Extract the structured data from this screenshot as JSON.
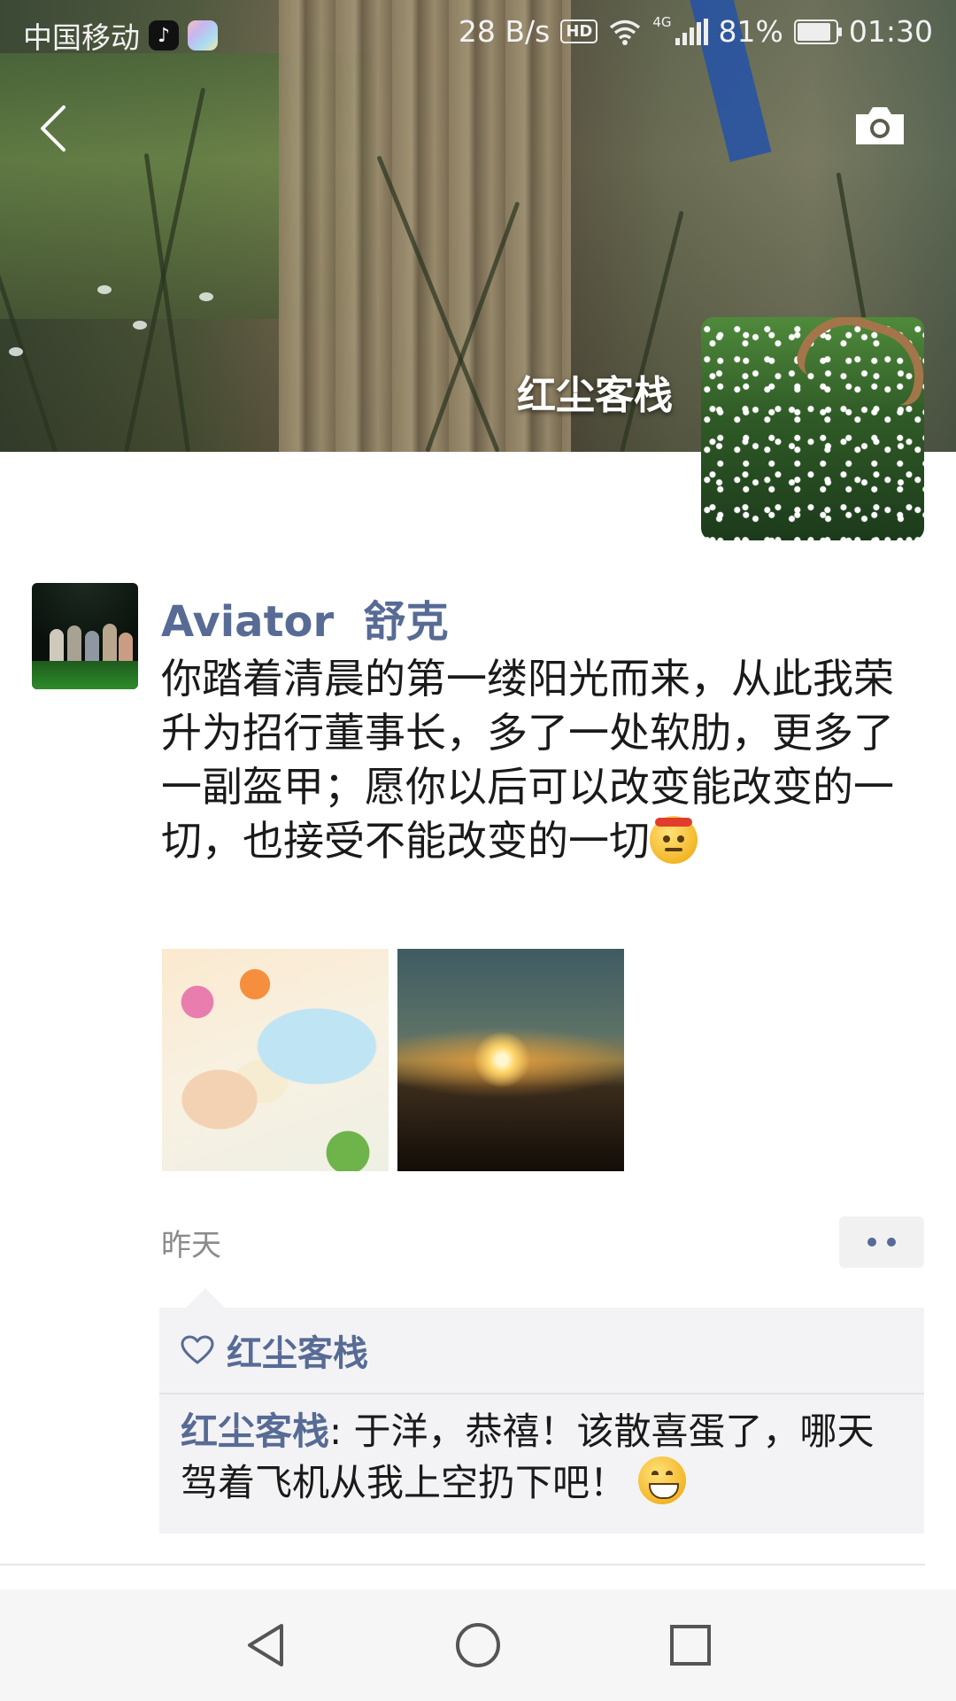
{
  "status_bar": {
    "carrier": "中国移动",
    "net_speed": "28 B/s",
    "hd_label": "HD",
    "network": "4G",
    "battery": "81%",
    "battery_level": 0.81,
    "time": "01:30"
  },
  "header": {
    "profile_name": "红尘客栈"
  },
  "post": {
    "author": "Aviator  舒克",
    "text": "你踏着清晨的第一缕阳光而来，从此我荣升为招行董事长，多了一处软肋，更多了一副盔甲；愿你以后可以改变能改变的一切，也接受不能改变的一切",
    "time": "昨天",
    "likes": [
      "红尘客栈"
    ],
    "comments": [
      {
        "author": "红尘客栈",
        "separator": ": ",
        "text": "于洋，恭禧！该散喜蛋了，哪天驾着飞机从我上空扔下吧！"
      }
    ]
  },
  "icons": {
    "back": "chevron-left-icon",
    "camera": "camera-icon",
    "like": "heart-outline-icon",
    "more": "more-dots-icon",
    "nav_back": "triangle-back-icon",
    "nav_home": "circle-home-icon",
    "nav_recents": "square-recents-icon"
  },
  "colors": {
    "link_blue": "#576b95",
    "comment_bg": "#f3f3f5",
    "nav_bg": "#f6f6f6"
  }
}
